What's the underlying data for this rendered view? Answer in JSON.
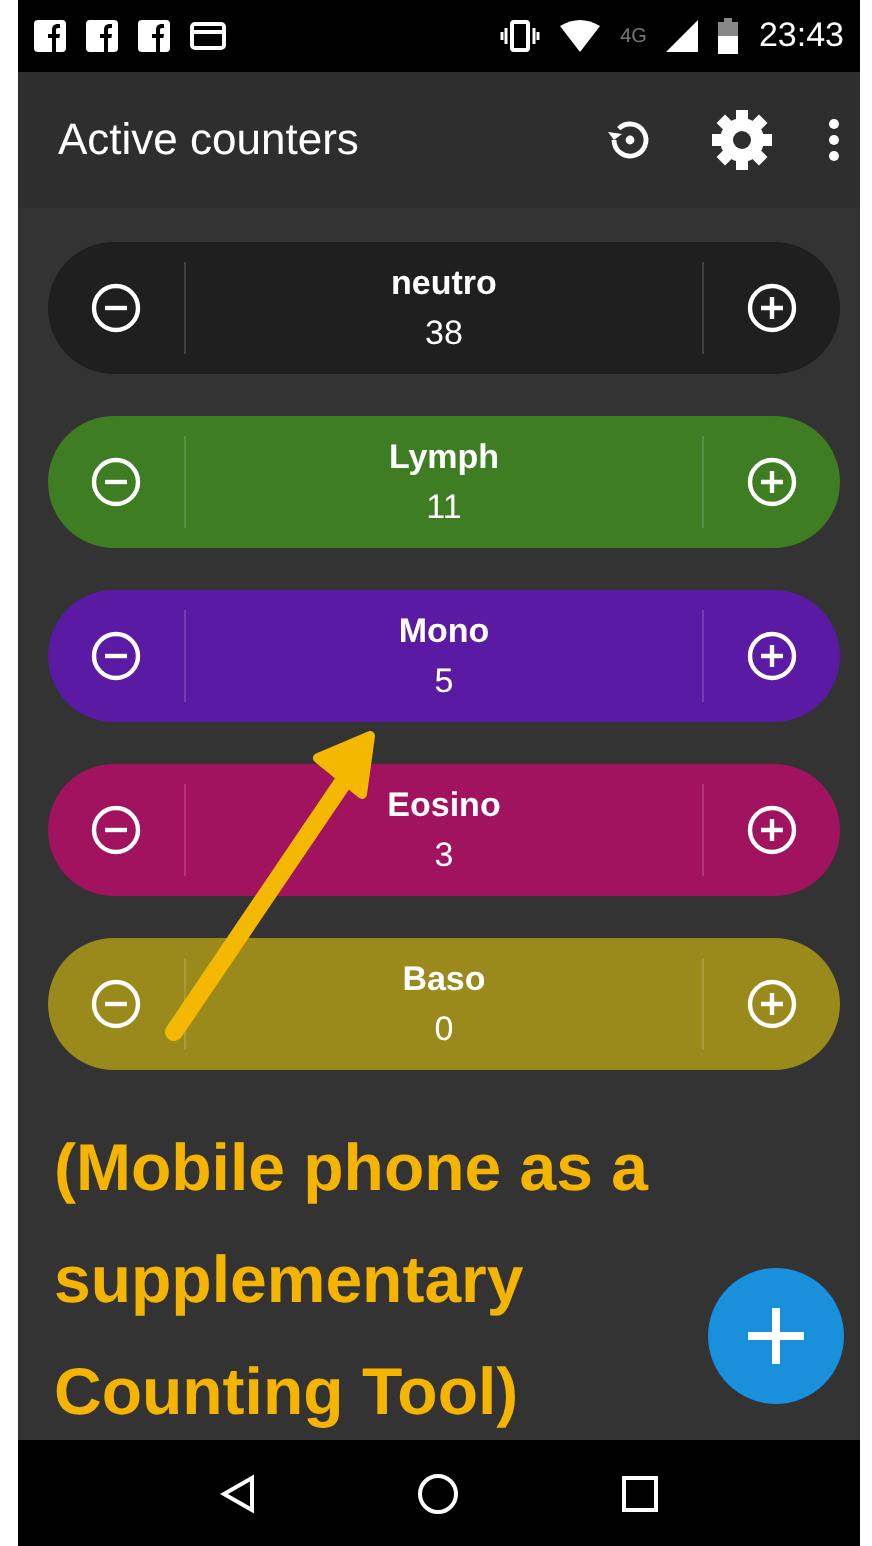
{
  "status_bar": {
    "network_type": "4G",
    "time": "23:43"
  },
  "app_bar": {
    "title": "Active counters"
  },
  "counters": [
    {
      "name": "neutro",
      "count": "38",
      "color": "#1f1f1f"
    },
    {
      "name": "Lymph",
      "count": "11",
      "color": "#3e7d22"
    },
    {
      "name": "Mono",
      "count": "5",
      "color": "#5b1aa3"
    },
    {
      "name": "Eosino",
      "count": "3",
      "color": "#a1125f"
    },
    {
      "name": "Baso",
      "count": "0",
      "color": "#9a8a1c"
    }
  ],
  "annotation": {
    "text": "(Mobile phone as a supplementary Counting Tool)"
  }
}
